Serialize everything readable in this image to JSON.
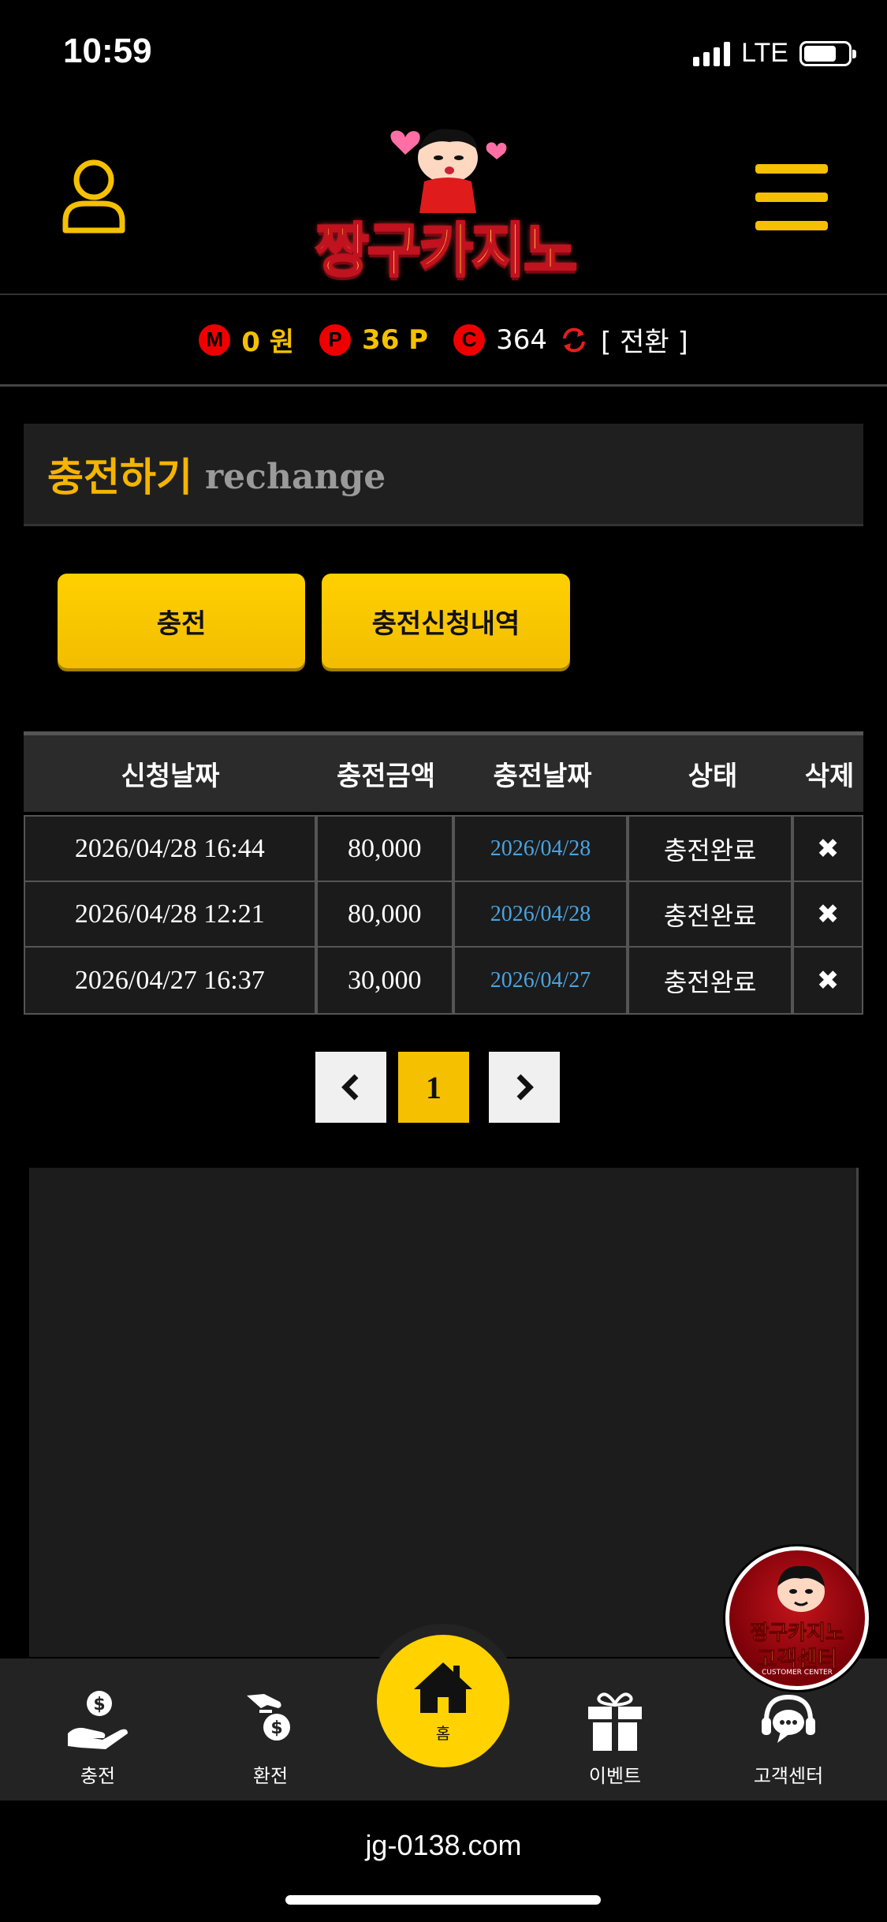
{
  "status_bar": {
    "time": "10:59",
    "network": "LTE"
  },
  "header": {
    "logo_text": "짱구카지노",
    "icons": {
      "user": "user-icon",
      "menu": "hamburger-menu-icon"
    }
  },
  "balance": {
    "money_badge": "M",
    "money_value": "0 원",
    "point_badge": "P",
    "point_value": "36 P",
    "coin_badge": "C",
    "coin_value": "364",
    "switch_label": "[ 전환 ]"
  },
  "section": {
    "title_ko": "충전하기",
    "title_en": "rechange"
  },
  "actions": {
    "charge_label": "충전",
    "history_label": "충전신청내역"
  },
  "table": {
    "headers": [
      "신청날짜",
      "충전금액",
      "충전날짜",
      "상태",
      "삭제"
    ],
    "rows": [
      {
        "request_date": "2026/04/28 16:44",
        "amount": "80,000",
        "charge_date": "2026/04/28",
        "status": "충전완료"
      },
      {
        "request_date": "2026/04/28 12:21",
        "amount": "80,000",
        "charge_date": "2026/04/28",
        "status": "충전완료"
      },
      {
        "request_date": "2026/04/27 16:37",
        "amount": "30,000",
        "charge_date": "2026/04/27",
        "status": "충전완료"
      }
    ]
  },
  "pagination": {
    "current": "1"
  },
  "customer_center": {
    "line1": "짱구카지노",
    "line2": "고객센터",
    "sub": "CUSTOMER CENTER"
  },
  "bottom_nav": {
    "charge": "충전",
    "exchange": "환전",
    "home": "홈",
    "event": "이벤트",
    "support": "고객센터"
  },
  "url": "jg-0138.com",
  "colors": {
    "accent": "#f5c000",
    "badge_red": "#e00000",
    "link_blue": "#4aa3df"
  }
}
